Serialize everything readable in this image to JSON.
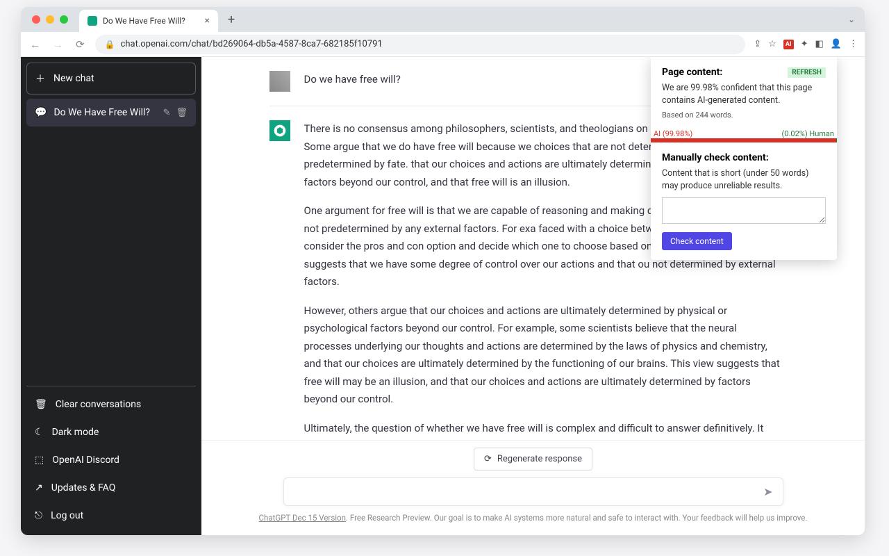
{
  "browser": {
    "tab_title": "Do We Have Free Will?",
    "url": "chat.openai.com/chat/bd269064-db5a-4587-8ca7-682185f10791"
  },
  "sidebar": {
    "new_chat": "New chat",
    "current_chat_title": "Do We Have Free Will?",
    "bottom": {
      "clear": "Clear conversations",
      "dark": "Dark mode",
      "discord": "OpenAI Discord",
      "faq": "Updates & FAQ",
      "logout": "Log out"
    }
  },
  "chat": {
    "user_msg": "Do we have free will?",
    "ai_p1": "There is no consensus among philosophers, scientists, and theologians on whether we have free will. Some argue that we do have free will because we choices that are not determined by prior causes or predetermined by fate. that our choices and actions are ultimately determined by physical or psych factors beyond our control, and that free will is an illusion.",
    "ai_p2": "One argument for free will is that we are capable of reasoning and making d that these decisions are not predetermined by any external factors. For exa faced with a choice between two options, we can consider the pros and con option and decide which one to choose based on our own values and priorit suggests that we have some degree of control over our actions and that ou not determined by external factors.",
    "ai_p3": "However, others argue that our choices and actions are ultimately determined by physical or psychological factors beyond our control. For example, some scientists believe that the neural processes underlying our thoughts and actions are determined by the laws of physics and chemistry, and that our choices are ultimately determined by the functioning of our brains. This view suggests that free will may be an illusion, and that our choices and actions are ultimately determined by factors beyond our control.",
    "ai_p4": "Ultimately, the question of whether we have free will is complex and difficult to answer definitively. It remains a subject of debate among philosophers, scientists, and theologians."
  },
  "footer": {
    "regen": "Regenerate response",
    "fineprint_link": "ChatGPT Dec 15 Version",
    "fineprint_rest": ". Free Research Preview. Our goal is to make AI systems more natural and safe to interact with. Your feedback will help us improve."
  },
  "popup": {
    "title": "Page content:",
    "refresh": "REFRESH",
    "confidence": "We are 99.98% confident that this page contains AI-generated content.",
    "basis": "Based on 244 words.",
    "ai_label": "AI (99.98%)",
    "human_label": "(0.02%) Human",
    "manual_title": "Manually check content:",
    "manual_note": "Content that is short (under 50 words) may produce unreliable results.",
    "check_btn": "Check content"
  }
}
